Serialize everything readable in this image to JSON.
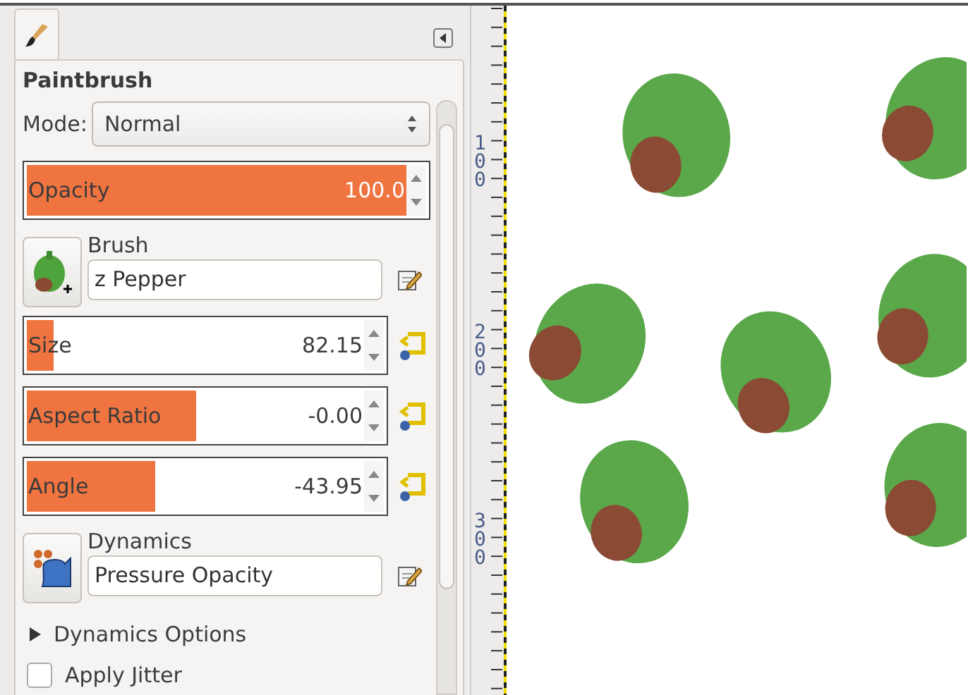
{
  "tab": {
    "selected": true
  },
  "tool_title": "Paintbrush",
  "mode": {
    "label": "Mode:",
    "value": "Normal"
  },
  "controls": [
    {
      "kind": "slider",
      "label": "Opacity",
      "value": "100.0",
      "level": 1,
      "reset": false
    },
    {
      "kind": "resource",
      "label": "Brush",
      "value": "z Pepper"
    },
    {
      "kind": "slider",
      "label": "Size",
      "value": "82.15",
      "level": 0.08,
      "reset": true
    },
    {
      "kind": "slider",
      "label": "Aspect Ratio",
      "value": "-0.00",
      "level": 0.5,
      "reset": true
    },
    {
      "kind": "slider",
      "label": "Angle",
      "value": "-43.95",
      "level": 0.38,
      "reset": true
    },
    {
      "kind": "resource",
      "label": "Dynamics",
      "value": "Pressure Opacity"
    },
    {
      "kind": "expander",
      "label": "Dynamics Options",
      "expanded": false
    },
    {
      "kind": "checkbox",
      "label": "Apply Jitter",
      "checked": false
    }
  ],
  "ruler": {
    "labels": [
      "100",
      "200",
      "300"
    ]
  }
}
